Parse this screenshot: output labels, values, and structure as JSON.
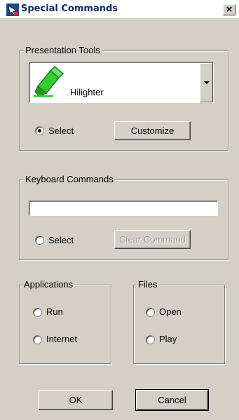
{
  "window": {
    "title": "Special Commands",
    "close_glyph": "×"
  },
  "presentation_tools": {
    "legend": "Presentation Tools",
    "selected_tool": "Hilighter",
    "tool_icon": "highlighter-icon",
    "select_label": "Select",
    "select_checked": true,
    "customize_label": "Customize"
  },
  "keyboard_commands": {
    "legend": "Keyboard Commands",
    "command_value": "",
    "select_label": "Select",
    "select_checked": false,
    "clear_label": "Clear Command"
  },
  "applications": {
    "legend": "Applications",
    "run_label": "Run",
    "internet_label": "Internet"
  },
  "files": {
    "legend": "Files",
    "open_label": "Open",
    "play_label": "Play"
  },
  "footer": {
    "ok_label": "OK",
    "cancel_label": "Cancel"
  },
  "colors": {
    "dialog_bg": "#d4d0c8",
    "title_text": "#0b2a6f",
    "highlighter_green": "#33cc33"
  }
}
